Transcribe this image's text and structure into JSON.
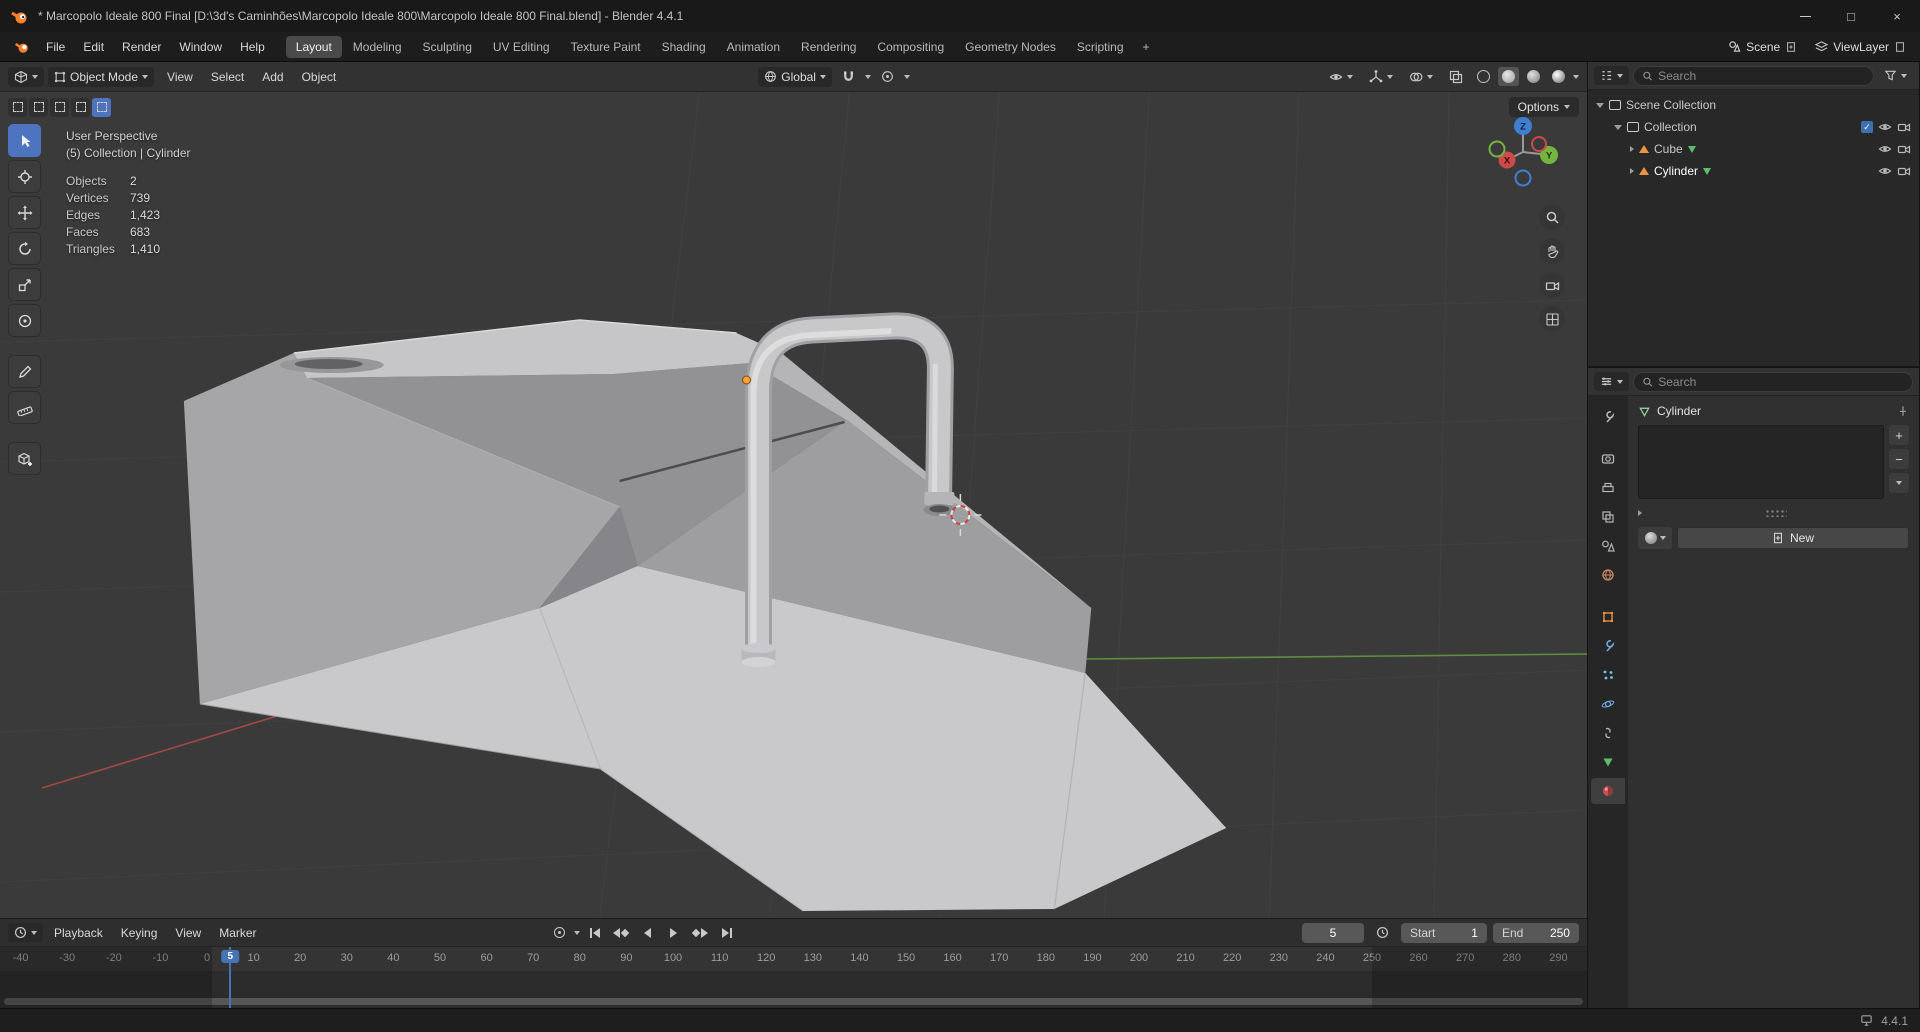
{
  "titlebar": {
    "title": "* Marcopolo Ideale 800 Final [D:\\3d's Caminhões\\Marcopolo Ideale 800\\Marcopolo Ideale 800 Final.blend] - Blender 4.4.1",
    "window_controls": {
      "maximize": "□",
      "close": "×"
    }
  },
  "menubar": {
    "menus": [
      {
        "label": "File"
      },
      {
        "label": "Edit"
      },
      {
        "label": "Render"
      },
      {
        "label": "Window"
      },
      {
        "label": "Help"
      }
    ],
    "workspaces": [
      {
        "label": "Layout",
        "active": true
      },
      {
        "label": "Modeling"
      },
      {
        "label": "Sculpting"
      },
      {
        "label": "UV Editing"
      },
      {
        "label": "Texture Paint"
      },
      {
        "label": "Shading"
      },
      {
        "label": "Animation"
      },
      {
        "label": "Rendering"
      },
      {
        "label": "Compositing"
      },
      {
        "label": "Geometry Nodes"
      },
      {
        "label": "Scripting"
      }
    ],
    "add_workspace": "+",
    "scene_selector": {
      "label": "Scene"
    },
    "view_layer_selector": {
      "label": "ViewLayer"
    }
  },
  "viewport_header": {
    "mode": "Object Mode",
    "menus": [
      {
        "label": "View"
      },
      {
        "label": "Select"
      },
      {
        "label": "Add"
      },
      {
        "label": "Object"
      }
    ],
    "orientation": "Global",
    "options_button": "Options"
  },
  "viewport": {
    "view_label": "User Perspective",
    "context_label": "(5) Collection | Cylinder",
    "stats": [
      {
        "label": "Objects",
        "value": "2"
      },
      {
        "label": "Vertices",
        "value": "739"
      },
      {
        "label": "Edges",
        "value": "1,423"
      },
      {
        "label": "Faces",
        "value": "683"
      },
      {
        "label": "Triangles",
        "value": "1,410"
      }
    ],
    "gizmo": {
      "x": "X",
      "y": "Y",
      "z": "Z"
    },
    "tools": [
      "tweak-select",
      "cursor",
      "move",
      "rotate",
      "scale",
      "transform",
      "annotate",
      "measure",
      "add-cube"
    ]
  },
  "outliner": {
    "search_placeholder": "Search",
    "rows": [
      {
        "label": "Scene Collection"
      },
      {
        "label": "Collection"
      },
      {
        "label": "Cube"
      },
      {
        "label": "Cylinder"
      }
    ]
  },
  "properties": {
    "search_placeholder": "Search",
    "breadcrumb": "Cylinder",
    "slot_add_label": "+",
    "slot_remove_label": "−",
    "new_button": "New"
  },
  "timeline": {
    "menus": [
      {
        "label": "Playback"
      },
      {
        "label": "Keying"
      },
      {
        "label": "View"
      },
      {
        "label": "Marker"
      }
    ],
    "current_frame": 5,
    "start_label": "Start",
    "start_value": "1",
    "end_label": "End",
    "end_value": "250",
    "ticks": [
      -40,
      -30,
      -20,
      -10,
      0,
      10,
      20,
      30,
      40,
      50,
      60,
      70,
      80,
      90,
      100,
      110,
      120,
      130,
      140,
      150,
      160,
      170,
      180,
      190,
      200,
      210,
      220,
      230,
      240,
      250,
      260,
      270,
      280,
      290
    ]
  },
  "statusbar": {
    "version": "4.4.1"
  }
}
